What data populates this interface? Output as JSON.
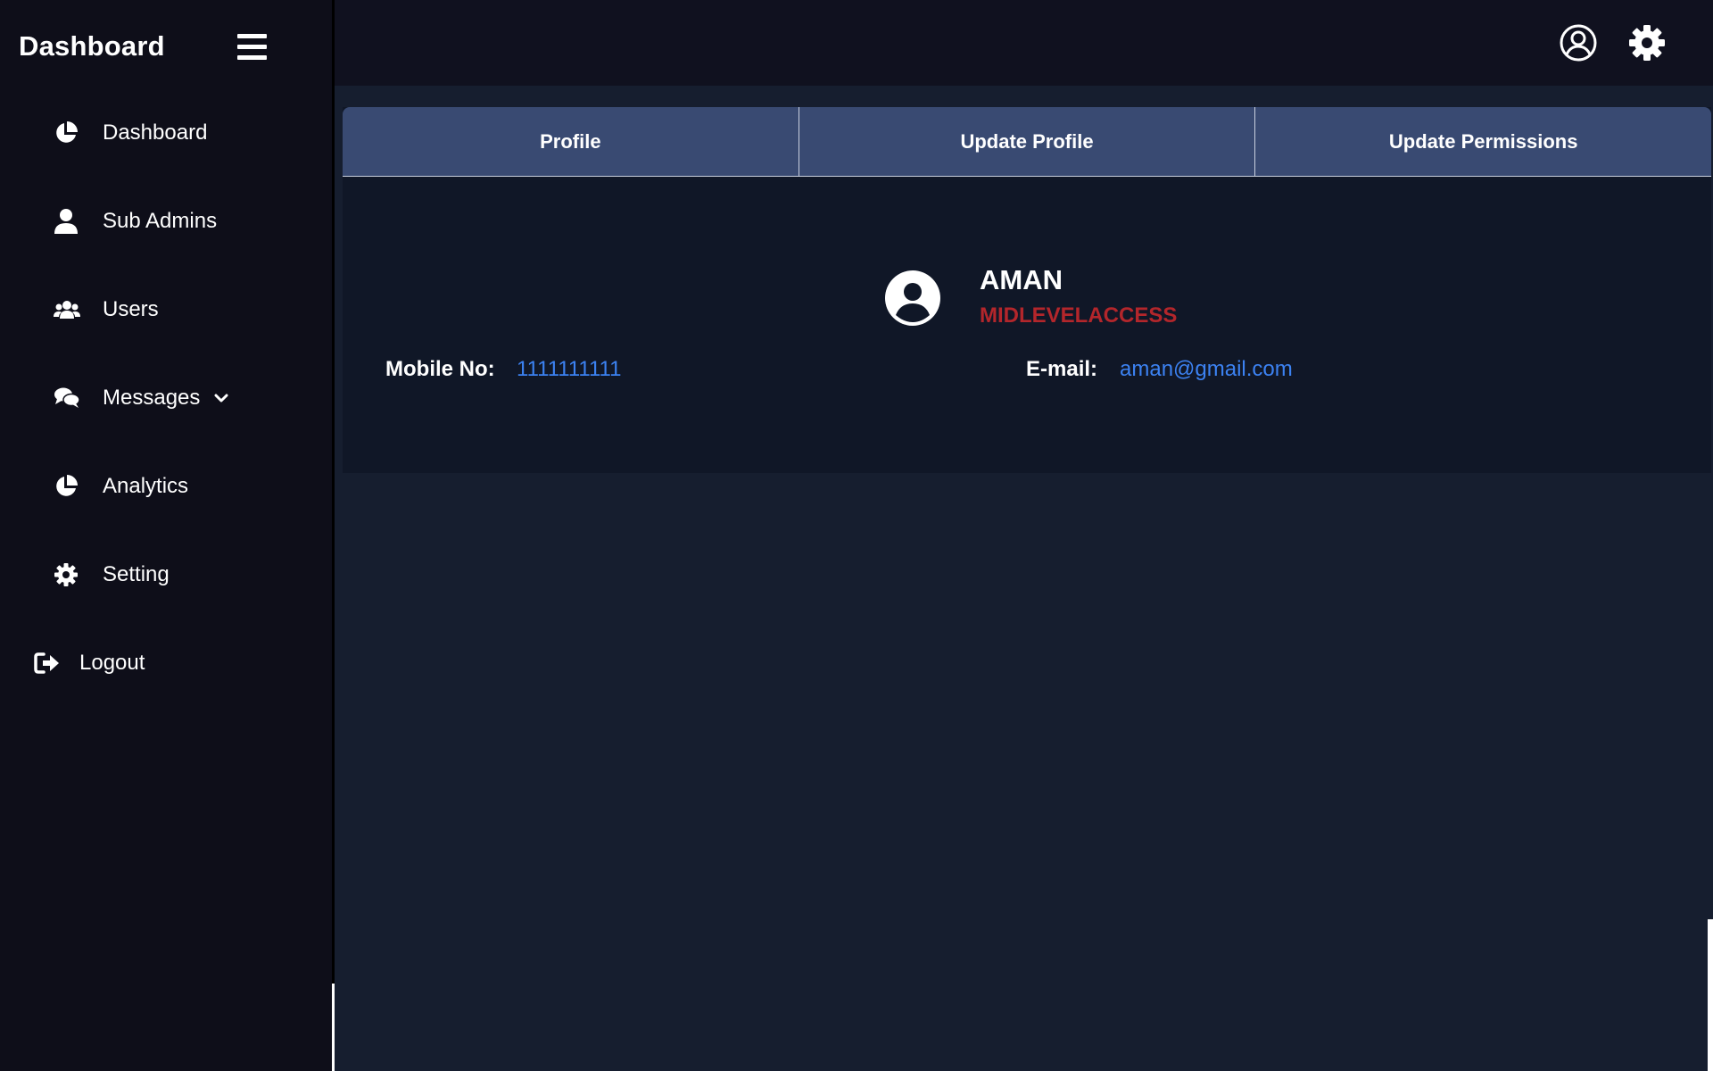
{
  "sidebar": {
    "brand": "Dashboard",
    "items": [
      {
        "label": "Dashboard",
        "icon": "pie-chart-icon"
      },
      {
        "label": "Sub Admins",
        "icon": "user-icon"
      },
      {
        "label": "Users",
        "icon": "users-icon"
      },
      {
        "label": "Messages",
        "icon": "comments-icon",
        "has_dropdown": true
      },
      {
        "label": "Analytics",
        "icon": "pie-chart-icon"
      },
      {
        "label": "Setting",
        "icon": "gear-icon"
      }
    ],
    "logout": {
      "label": "Logout",
      "icon": "logout-icon"
    }
  },
  "topbar": {
    "icons": [
      "user-circle-icon",
      "gear-icon"
    ]
  },
  "tabs": [
    "Profile",
    "Update Profile",
    "Update Permissions"
  ],
  "profile": {
    "name": "AMAN",
    "role": "MIDLEVELACCESS",
    "mobile_label": "Mobile No:",
    "mobile_value": "1111111111",
    "email_label": "E-mail:",
    "email_value": "aman@gmail.com"
  },
  "colors": {
    "sidebar_bg": "#0e0e19",
    "page_bg": "#161e2f",
    "card_bg": "#101727",
    "tab_bg": "#394a72",
    "role_red": "#b3262b",
    "link_blue": "#3c82f2"
  }
}
